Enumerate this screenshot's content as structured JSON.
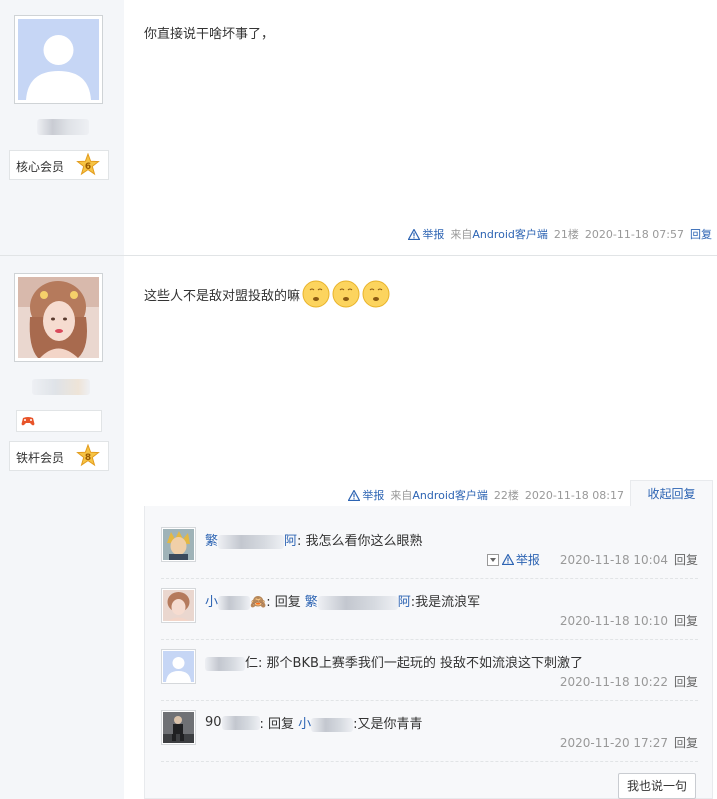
{
  "posts": [
    {
      "user": {
        "badge_label": "核心会员",
        "badge_level": "6"
      },
      "content": "你直接说干啥坏事了，",
      "meta": {
        "report": "举报",
        "client_prefix": "来自",
        "client": "Android客户端",
        "floor": "21楼",
        "time": "2020-11-18 07:57",
        "reply": "回复"
      }
    },
    {
      "user": {
        "badge_label": "铁杆会员",
        "badge_level": "8"
      },
      "content": "这些人不是敌对盟投敌的嘛",
      "meta": {
        "report": "举报",
        "client_prefix": "来自",
        "client": "Android客户端",
        "floor": "22楼",
        "time": "2020-11-18 08:17",
        "fold": "收起回复"
      },
      "replies": [
        {
          "name_prefix": "繁",
          "name_suffix": "阿",
          "text": ": 我怎么看你这么眼熟",
          "report": "举报",
          "time": "2020-11-18 10:04",
          "reply": "回复"
        },
        {
          "name_prefix": "小",
          "name_suffix": "",
          "reply_word": ": 回复",
          "target_prefix": "繁",
          "target_suffix": "阿",
          "text": " :我是流浪军",
          "time": "2020-11-18 10:10",
          "reply": "回复"
        },
        {
          "name_prefix": "",
          "name_suffix": "仁",
          "text": ": 那个BKB上赛季我们一起玩的 投敌不如流浪这下刺激了",
          "time": "2020-11-18 10:22",
          "reply": "回复"
        },
        {
          "name_prefix": "90",
          "name_suffix": "",
          "reply_word": ": 回复",
          "target_prefix": "小",
          "target_suffix": "",
          "text": " :又是你青青",
          "time": "2020-11-20 17:27",
          "reply": "回复"
        }
      ],
      "say_button": "我也说一句"
    }
  ],
  "colors": {
    "link": "#2d64b3",
    "meta": "#999999",
    "sidebar": "#f4f6f9",
    "reply_box": "#f7f8fa"
  },
  "icons": [
    "warning-icon",
    "level-star-icon",
    "game-controller-icon",
    "emoji-icon",
    "dropdown-icon"
  ]
}
